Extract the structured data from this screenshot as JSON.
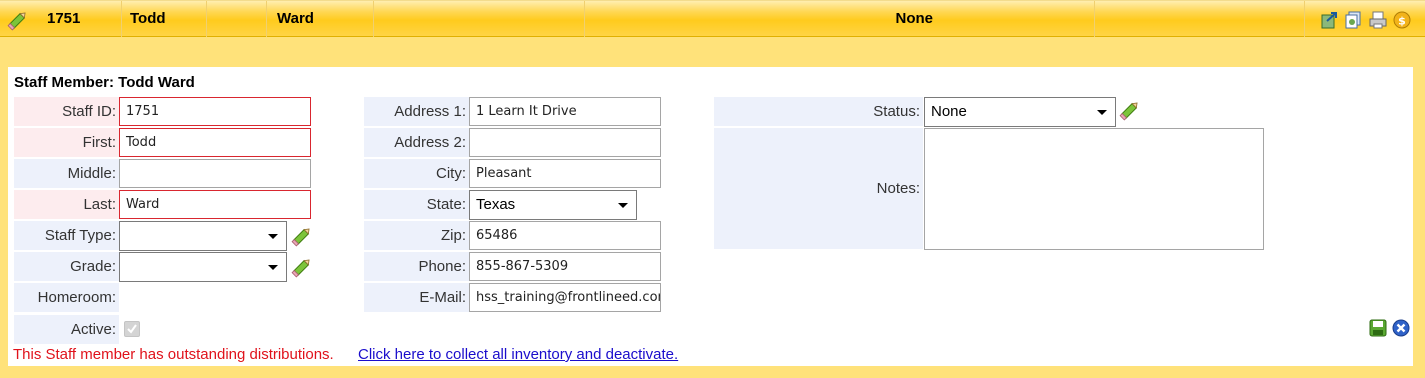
{
  "header": {
    "staff_id": "1751",
    "first": "Todd",
    "last": "Ward",
    "status": "None"
  },
  "form": {
    "title": "Staff Member: Todd Ward",
    "labels": {
      "staff_id": "Staff ID:",
      "first": "First:",
      "middle": "Middle:",
      "last": "Last:",
      "staff_type": "Staff Type:",
      "grade": "Grade:",
      "homeroom": "Homeroom:",
      "active": "Active:",
      "address1": "Address 1:",
      "address2": "Address 2:",
      "city": "City:",
      "state": "State:",
      "zip": "Zip:",
      "phone": "Phone:",
      "email": "E-Mail:",
      "status": "Status:",
      "notes": "Notes:"
    },
    "values": {
      "staff_id": "1751",
      "first": "Todd",
      "middle": "",
      "last": "Ward",
      "staff_type": "",
      "grade": "",
      "address1": "1 Learn It Drive",
      "address2": "",
      "city": "Pleasant",
      "state": "Texas",
      "zip": "65486",
      "phone": "855-867-5309",
      "email": "hss_training@frontlineed.com",
      "status": "None",
      "notes": "",
      "active": true
    },
    "warning": "This Staff member has outstanding distributions.",
    "collect_link": "Click here to collect all inventory and deactivate."
  },
  "colors": {
    "header_gold": "#ffcb1d",
    "background": "#ffe27a",
    "required_border": "#d9262f",
    "warning_text": "#e0121b",
    "link": "#1a0dcc"
  },
  "icons": [
    "edit-pencil-icon",
    "export-icon",
    "copy-icon",
    "print-icon",
    "money-icon",
    "save-icon",
    "cancel-icon"
  ]
}
